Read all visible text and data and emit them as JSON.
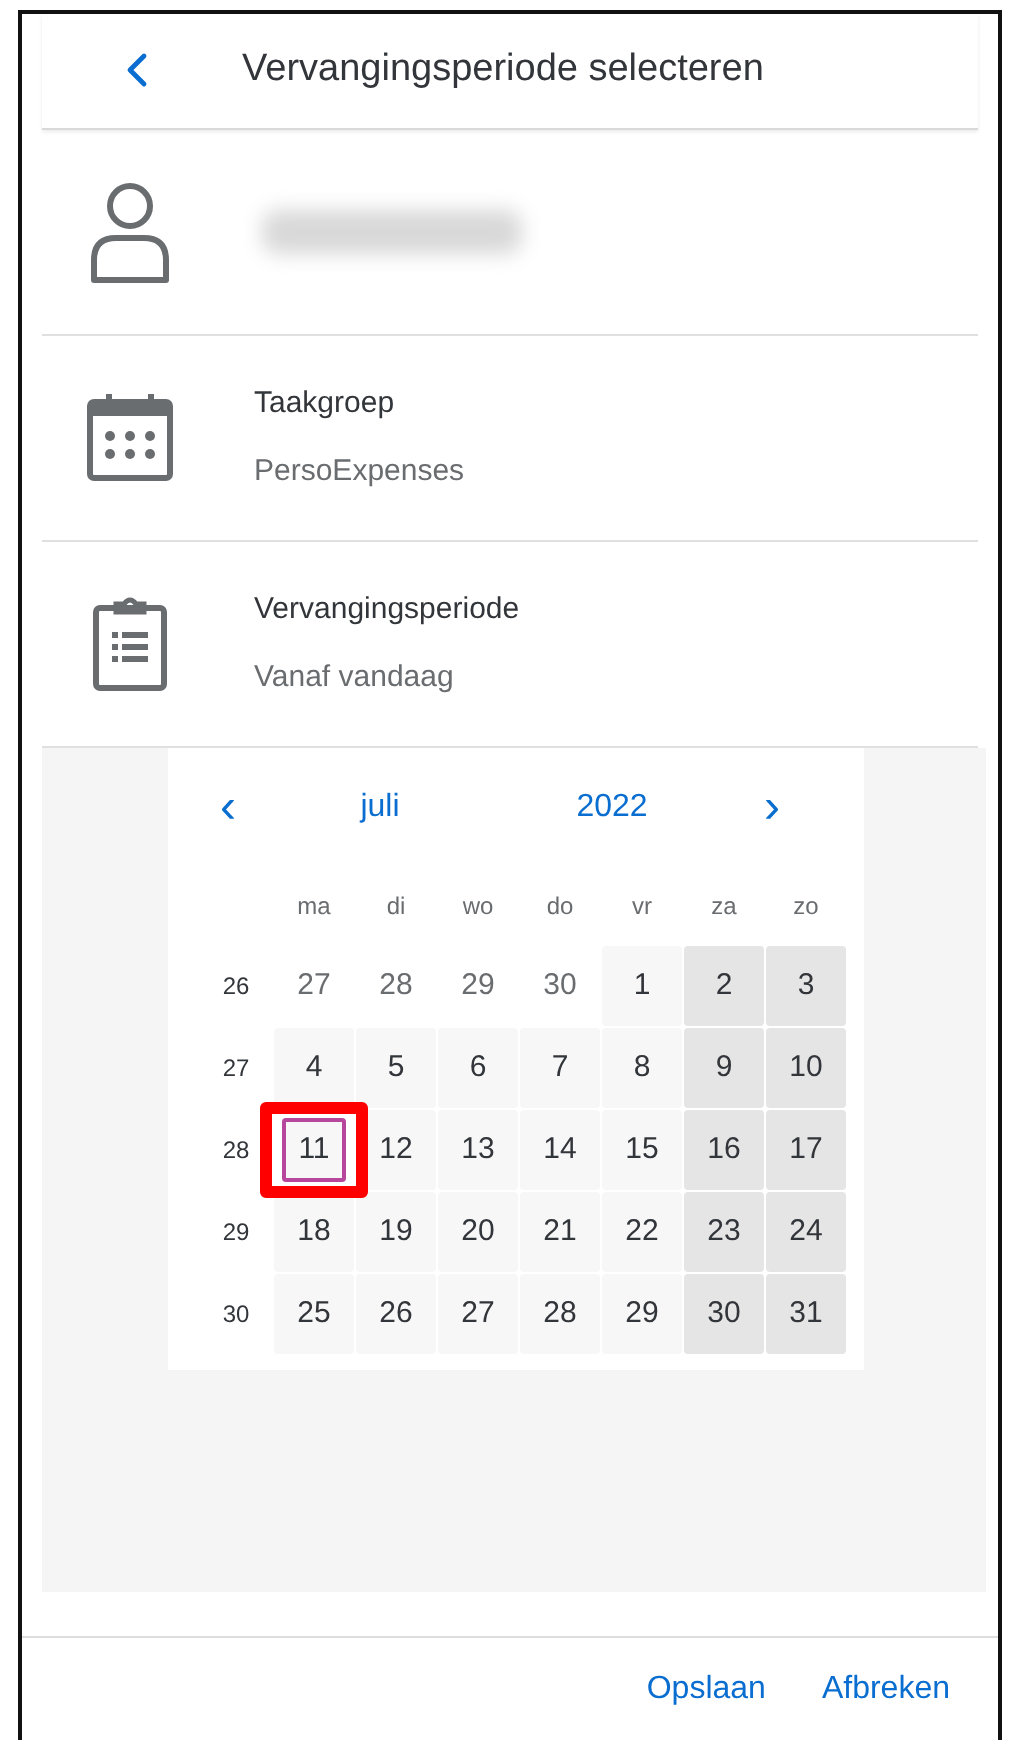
{
  "header": {
    "title": "Vervangingsperiode selecteren"
  },
  "rows": [
    {
      "kind": "person"
    },
    {
      "kind": "group",
      "label": "Taakgroep",
      "value": "PersoExpenses"
    },
    {
      "kind": "period",
      "label": "Vervangingsperiode",
      "value": "Vanaf vandaag"
    }
  ],
  "calendar": {
    "prev": "‹",
    "month": "juli",
    "year": "2022",
    "next": "›",
    "weekdays": [
      "ma",
      "di",
      "wo",
      "do",
      "vr",
      "za",
      "zo"
    ],
    "weeks": [
      {
        "number": "26",
        "days": [
          {
            "text": "27",
            "kind": "outside",
            "today": false,
            "annotated": false
          },
          {
            "text": "28",
            "kind": "outside",
            "today": false,
            "annotated": false
          },
          {
            "text": "29",
            "kind": "outside",
            "today": false,
            "annotated": false
          },
          {
            "text": "30",
            "kind": "outside",
            "today": false,
            "annotated": false
          },
          {
            "text": "1",
            "kind": "weekday",
            "today": false,
            "annotated": false
          },
          {
            "text": "2",
            "kind": "weekend",
            "today": false,
            "annotated": false
          },
          {
            "text": "3",
            "kind": "weekend",
            "today": false,
            "annotated": false
          }
        ]
      },
      {
        "number": "27",
        "days": [
          {
            "text": "4",
            "kind": "weekday",
            "today": false,
            "annotated": false
          },
          {
            "text": "5",
            "kind": "weekday",
            "today": false,
            "annotated": false
          },
          {
            "text": "6",
            "kind": "weekday",
            "today": false,
            "annotated": false
          },
          {
            "text": "7",
            "kind": "weekday",
            "today": false,
            "annotated": false
          },
          {
            "text": "8",
            "kind": "weekday",
            "today": false,
            "annotated": false
          },
          {
            "text": "9",
            "kind": "weekend",
            "today": false,
            "annotated": false
          },
          {
            "text": "10",
            "kind": "weekend",
            "today": false,
            "annotated": false
          }
        ]
      },
      {
        "number": "28",
        "days": [
          {
            "text": "11",
            "kind": "weekday",
            "today": true,
            "annotated": true
          },
          {
            "text": "12",
            "kind": "weekday",
            "today": false,
            "annotated": false
          },
          {
            "text": "13",
            "kind": "weekday",
            "today": false,
            "annotated": false
          },
          {
            "text": "14",
            "kind": "weekday",
            "today": false,
            "annotated": false
          },
          {
            "text": "15",
            "kind": "weekday",
            "today": false,
            "annotated": false
          },
          {
            "text": "16",
            "kind": "weekend",
            "today": false,
            "annotated": false
          },
          {
            "text": "17",
            "kind": "weekend",
            "today": false,
            "annotated": false
          }
        ]
      },
      {
        "number": "29",
        "days": [
          {
            "text": "18",
            "kind": "weekday",
            "today": false,
            "annotated": false
          },
          {
            "text": "19",
            "kind": "weekday",
            "today": false,
            "annotated": false
          },
          {
            "text": "20",
            "kind": "weekday",
            "today": false,
            "annotated": false
          },
          {
            "text": "21",
            "kind": "weekday",
            "today": false,
            "annotated": false
          },
          {
            "text": "22",
            "kind": "weekday",
            "today": false,
            "annotated": false
          },
          {
            "text": "23",
            "kind": "weekend",
            "today": false,
            "annotated": false
          },
          {
            "text": "24",
            "kind": "weekend",
            "today": false,
            "annotated": false
          }
        ]
      },
      {
        "number": "30",
        "days": [
          {
            "text": "25",
            "kind": "weekday",
            "today": false,
            "annotated": false
          },
          {
            "text": "26",
            "kind": "weekday",
            "today": false,
            "annotated": false
          },
          {
            "text": "27",
            "kind": "weekday",
            "today": false,
            "annotated": false
          },
          {
            "text": "28",
            "kind": "weekday",
            "today": false,
            "annotated": false
          },
          {
            "text": "29",
            "kind": "weekday",
            "today": false,
            "annotated": false
          },
          {
            "text": "30",
            "kind": "weekend",
            "today": false,
            "annotated": false
          },
          {
            "text": "31",
            "kind": "weekend",
            "today": false,
            "annotated": false
          }
        ]
      }
    ]
  },
  "footer": {
    "buttons": [
      "Opslaan",
      "Afbreken"
    ]
  }
}
